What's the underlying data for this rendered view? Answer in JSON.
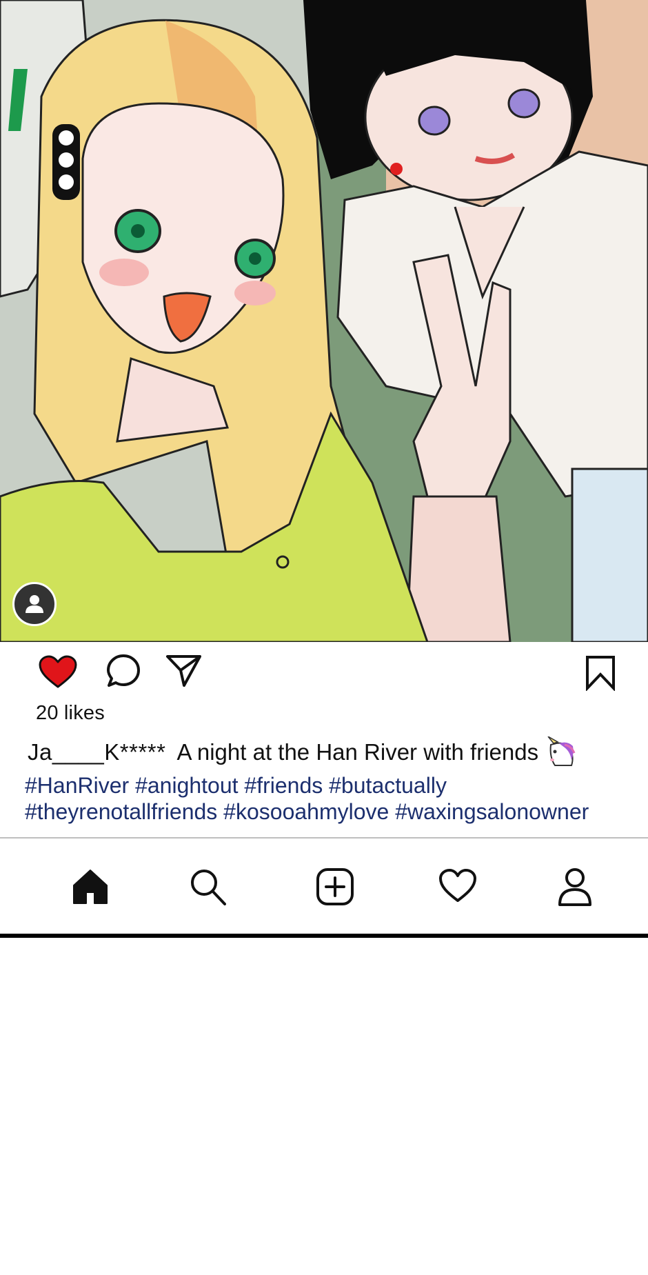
{
  "post": {
    "likes_text": "20 likes",
    "username": "Ja____K*****",
    "caption": "A night at the Han River with friends",
    "emoji": "unicorn-emoji",
    "hashtags_line1": "#HanRiver #anightout #friends #butactually",
    "hashtags_line2": "#theyrenotallfriends #kosooahmylove #waxingsalonowner",
    "liked": true
  },
  "icons": {
    "like": "heart-icon",
    "comment": "comment-icon",
    "share": "send-icon",
    "bookmark": "bookmark-icon",
    "home": "home-icon",
    "search": "search-icon",
    "add": "add-post-icon",
    "activity": "heart-outline-icon",
    "profile": "profile-icon"
  },
  "colors": {
    "like_red": "#e0151a",
    "hashtag": "#1c2f6e",
    "text": "#111111"
  }
}
